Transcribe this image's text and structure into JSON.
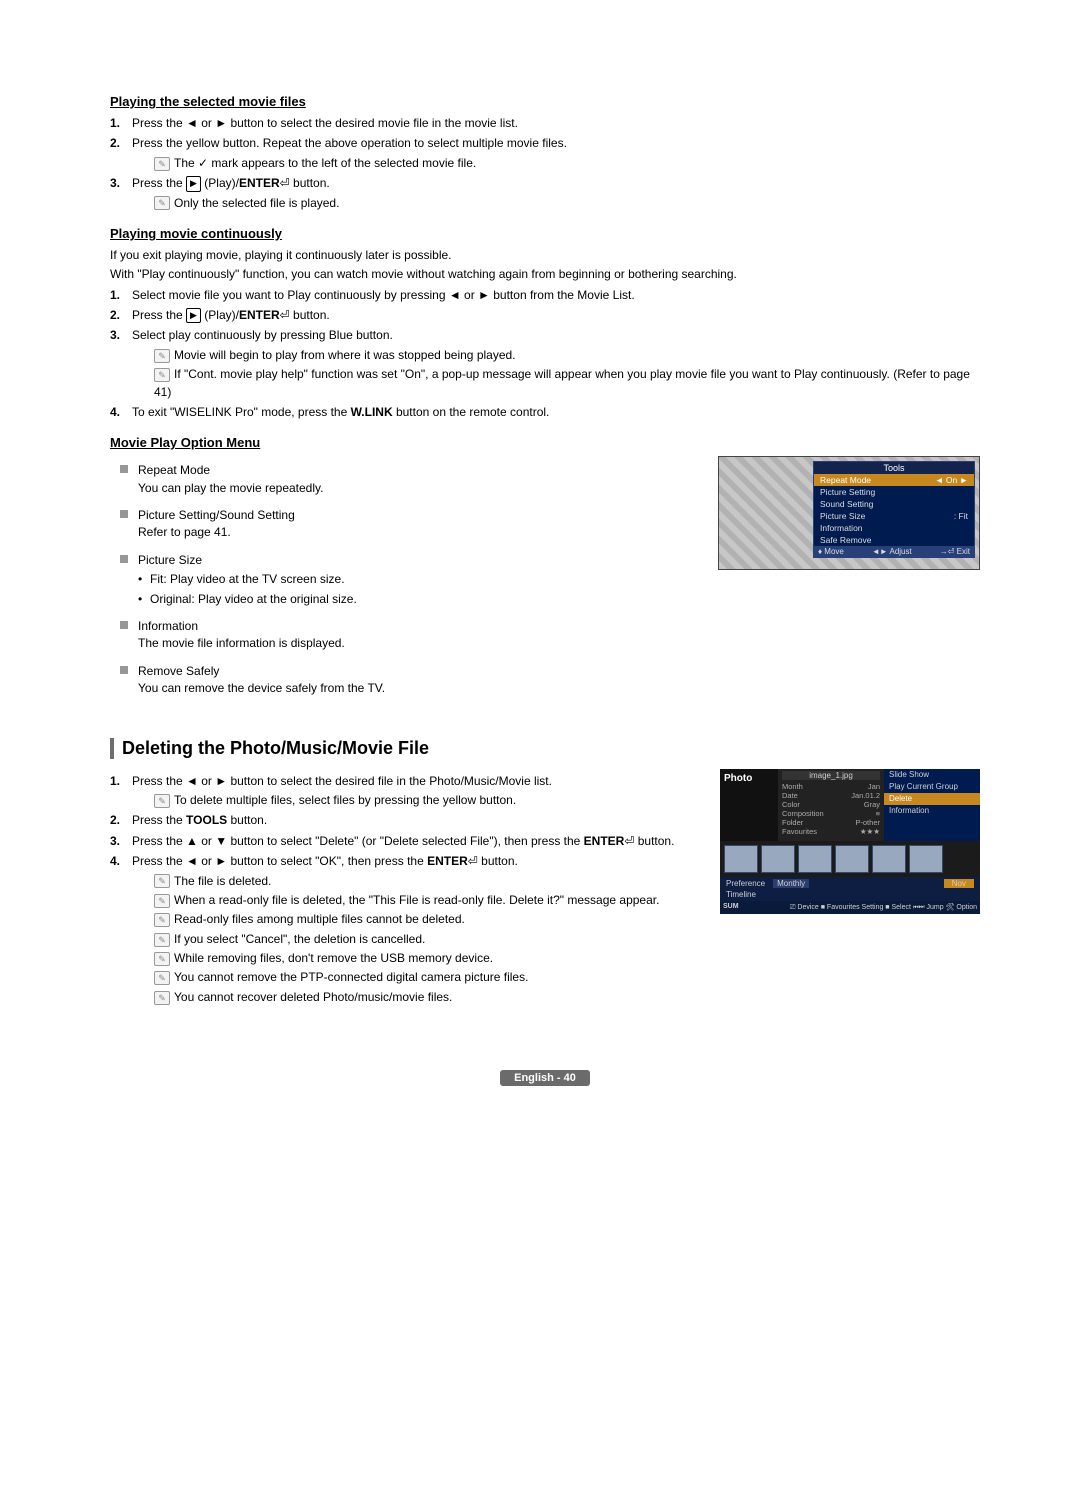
{
  "section1": {
    "title": "Playing the selected movie files",
    "items": [
      "Press the ◄ or ► button to select the desired movie file in the movie list.",
      "Press the yellow button. Repeat the above operation to select multiple movie files.",
      "Press the ▶ (Play)/ENTER⏎ button."
    ],
    "sub2": "The ✓ mark appears to the left of the selected movie file.",
    "sub3": "Only the selected file is played."
  },
  "section2": {
    "title": "Playing movie continuously",
    "intro1": "If you exit playing movie, playing it continuously later is possible.",
    "intro2": "With \"Play continuously\" function, you can watch movie without watching again from beginning or bothering searching.",
    "items": [
      "Select movie file you want to Play continuously by pressing ◄ or ► button from the Movie List.",
      "Press the ▶ (Play)/ENTER⏎ button.",
      "Select play continuously by pressing Blue button.",
      "To exit \"WISELINK Pro\" mode, press the W.LINK button on the remote control."
    ],
    "sub3a": "Movie will begin to play from where it was stopped being played.",
    "sub3b": "If \"Cont. movie play help\" function was set \"On\", a pop-up message will appear when you play movie file you want to Play continuously. (Refer to page 41)"
  },
  "section3": {
    "title": "Movie Play Option Menu",
    "opts": [
      {
        "h": "Repeat Mode",
        "d": "You can play the movie repeatedly."
      },
      {
        "h": "Picture Setting/Sound Setting",
        "d": "Refer to page 41."
      },
      {
        "h": "Picture Size",
        "d": "",
        "bullets": [
          "Fit: Play video at the TV screen size.",
          "Original: Play video at the original size."
        ]
      },
      {
        "h": "Information",
        "d": "The movie file information is displayed."
      },
      {
        "h": "Remove Safely",
        "d": "You can remove the device safely from the TV."
      }
    ]
  },
  "tools": {
    "title": "Tools",
    "rows": [
      {
        "l": "Repeat Mode",
        "r": "◄   On   ►",
        "sel": true
      },
      {
        "l": "Picture Setting",
        "r": ""
      },
      {
        "l": "Sound Setting",
        "r": ""
      },
      {
        "l": "Picture Size",
        "r": ":      Fit"
      },
      {
        "l": "Information",
        "r": ""
      },
      {
        "l": "Safe Remove",
        "r": ""
      }
    ],
    "foot": {
      "a": "♦ Move",
      "b": "◄► Adjust",
      "c": "→⏎ Exit"
    }
  },
  "section4": {
    "title": "Deleting the Photo/Music/Movie File",
    "items": [
      "Press the ◄ or ► button to select the desired file in the Photo/Music/Movie list.",
      "Press the TOOLS button.",
      "Press the ▲ or ▼ button to select \"Delete\" (or \"Delete selected File\"), then press the ENTER⏎ button.",
      "Press the ◄ or ► button to select \"OK\", then press the ENTER⏎ button."
    ],
    "sub1": "To delete multiple files, select files by pressing the yellow button.",
    "notes": [
      "The file is deleted.",
      "When a read-only file is deleted, the \"This File is read-only file. Delete it?\" message appear.",
      "Read-only files among multiple files cannot be deleted.",
      "If you select \"Cancel\", the deletion is cancelled.",
      "While removing files, don't remove the USB memory device.",
      "You cannot remove the PTP-connected digital camera picture files.",
      "You cannot recover deleted Photo/music/movie files."
    ]
  },
  "photo": {
    "side": "Photo",
    "fname": "image_1.jpg",
    "meta": [
      {
        "k": "Month",
        "v": "Jan"
      },
      {
        "k": "Date",
        "v": "Jan.01.2"
      },
      {
        "k": "Color",
        "v": "Gray"
      },
      {
        "k": "Composition",
        "v": "≡"
      },
      {
        "k": "Folder",
        "v": "P-other"
      },
      {
        "k": "Favourites",
        "v": "★★★"
      }
    ],
    "menu": [
      "Slide Show",
      "Play Current Group",
      "Delete",
      "Information"
    ],
    "menuSel": 2,
    "tabs": [
      "Preference",
      "Monthly",
      "Timeline"
    ],
    "tabNov": "Nov",
    "sum": "SUM",
    "foot": "⎚ Device   ■ Favourites Setting   ■ Select   ⏮⏭ Jump   🛠 Option"
  },
  "footer": "English - 40"
}
